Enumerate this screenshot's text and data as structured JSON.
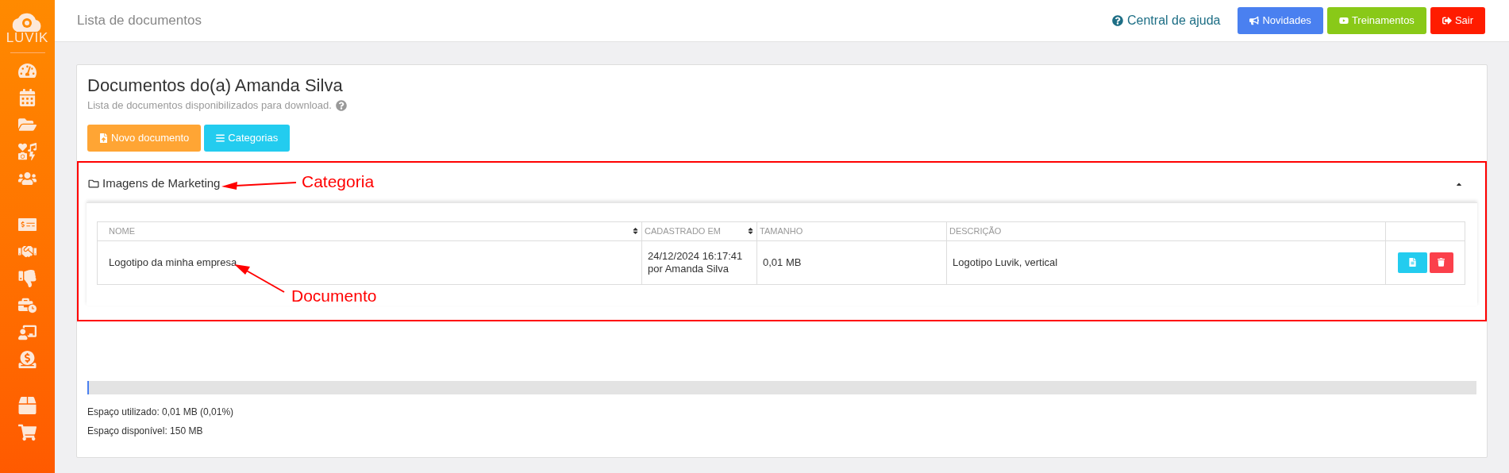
{
  "sidebar": {
    "logo": "LUVIK"
  },
  "header": {
    "title": "Lista de documentos",
    "help_link": "Central de ajuda",
    "buttons": [
      {
        "label": "Novidades",
        "kind": "news"
      },
      {
        "label": "Treinamentos",
        "kind": "video"
      },
      {
        "label": "Sair",
        "kind": "logout"
      }
    ]
  },
  "card": {
    "title": "Documentos do(a) Amanda Silva",
    "subtitle": "Lista de documentos disponibilizados para download.",
    "buttons": [
      {
        "label": "Novo documento",
        "kind": "new"
      },
      {
        "label": "Categorias",
        "kind": "list"
      }
    ],
    "category": {
      "name": "Imagens de Marketing",
      "expanded": true,
      "table": {
        "columns": [
          {
            "label": "NOME",
            "sortable": true
          },
          {
            "label": "CADASTRADO EM",
            "sortable": true
          },
          {
            "label": "TAMANHO",
            "sortable": false
          },
          {
            "label": "DESCRIÇÃO",
            "sortable": false
          }
        ],
        "rows": [
          {
            "name": "Logotipo da minha empresa",
            "created": [
              "24/12/2024 16:17:41",
              "por Amanda Silva"
            ],
            "size": "0,01 MB",
            "description": "Logotipo Luvik, vertical"
          }
        ]
      }
    },
    "annotations": [
      {
        "label": "Categoria",
        "kind": "category"
      },
      {
        "label": "Documento",
        "kind": "document"
      }
    ],
    "storage": {
      "level": 0.0001,
      "used": "Espaço utilizado: 0,01 MB (0,01%)",
      "available": "Espaço disponível: 150 MB"
    }
  }
}
